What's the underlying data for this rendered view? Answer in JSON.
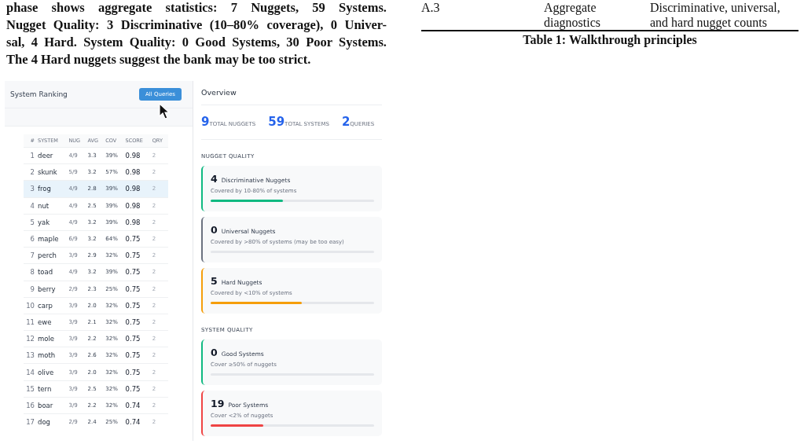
{
  "paragraph_lines": [
    "phase shows aggregate statistics: 7 Nuggets, 59 Systems.",
    "Nugget Quality: 3 Discriminative (10–80% coverage), 0 Univer-",
    "sal, 4 Hard. System Quality: 0 Good Systems, 30 Poor Systems.",
    "The 4 Hard nuggets suggest the bank may be too strict."
  ],
  "table_fragment": {
    "row": {
      "id": "A.3",
      "principle": "Aggregate diagnostics",
      "check": "Discriminative, universal, and hard nugget counts"
    },
    "caption": "Table 1: Walkthrough principles"
  },
  "screenshot": {
    "ranking": {
      "title": "System Ranking",
      "button": "All Queries",
      "columns": [
        "#",
        "SYSTEM",
        "NUG",
        "AVG",
        "COV",
        "SCORE",
        "QRY"
      ],
      "rows": [
        {
          "rank": "1",
          "system": "deer",
          "nug": "4/9",
          "avg": "3.3",
          "cov": "39%",
          "score": "0.98",
          "qry": "2",
          "selected": false
        },
        {
          "rank": "2",
          "system": "skunk",
          "nug": "5/9",
          "avg": "3.2",
          "cov": "57%",
          "score": "0.98",
          "qry": "2",
          "selected": false
        },
        {
          "rank": "3",
          "system": "frog",
          "nug": "4/9",
          "avg": "2.8",
          "cov": "39%",
          "score": "0.98",
          "qry": "2",
          "selected": true
        },
        {
          "rank": "4",
          "system": "nut",
          "nug": "4/9",
          "avg": "2.5",
          "cov": "39%",
          "score": "0.98",
          "qry": "2",
          "selected": false
        },
        {
          "rank": "5",
          "system": "yak",
          "nug": "4/9",
          "avg": "3.2",
          "cov": "39%",
          "score": "0.98",
          "qry": "2",
          "selected": false
        },
        {
          "rank": "6",
          "system": "maple",
          "nug": "6/9",
          "avg": "3.2",
          "cov": "64%",
          "score": "0.75",
          "qry": "2",
          "selected": false
        },
        {
          "rank": "7",
          "system": "perch",
          "nug": "3/9",
          "avg": "2.9",
          "cov": "32%",
          "score": "0.75",
          "qry": "2",
          "selected": false
        },
        {
          "rank": "8",
          "system": "toad",
          "nug": "4/9",
          "avg": "3.2",
          "cov": "39%",
          "score": "0.75",
          "qry": "2",
          "selected": false
        },
        {
          "rank": "9",
          "system": "berry",
          "nug": "2/9",
          "avg": "2.3",
          "cov": "25%",
          "score": "0.75",
          "qry": "2",
          "selected": false
        },
        {
          "rank": "10",
          "system": "carp",
          "nug": "3/9",
          "avg": "2.0",
          "cov": "32%",
          "score": "0.75",
          "qry": "2",
          "selected": false
        },
        {
          "rank": "11",
          "system": "ewe",
          "nug": "3/9",
          "avg": "2.1",
          "cov": "32%",
          "score": "0.75",
          "qry": "2",
          "selected": false
        },
        {
          "rank": "12",
          "system": "mole",
          "nug": "3/9",
          "avg": "2.2",
          "cov": "32%",
          "score": "0.75",
          "qry": "2",
          "selected": false
        },
        {
          "rank": "13",
          "system": "moth",
          "nug": "3/9",
          "avg": "2.6",
          "cov": "32%",
          "score": "0.75",
          "qry": "2",
          "selected": false
        },
        {
          "rank": "14",
          "system": "olive",
          "nug": "3/9",
          "avg": "2.0",
          "cov": "32%",
          "score": "0.75",
          "qry": "2",
          "selected": false
        },
        {
          "rank": "15",
          "system": "tern",
          "nug": "3/9",
          "avg": "2.5",
          "cov": "32%",
          "score": "0.75",
          "qry": "2",
          "selected": false
        },
        {
          "rank": "16",
          "system": "boar",
          "nug": "3/9",
          "avg": "2.2",
          "cov": "32%",
          "score": "0.74",
          "qry": "2",
          "selected": false
        },
        {
          "rank": "17",
          "system": "dog",
          "nug": "2/9",
          "avg": "2.4",
          "cov": "25%",
          "score": "0.74",
          "qry": "2",
          "selected": false
        }
      ]
    },
    "overview": {
      "title": "Overview",
      "stats": [
        {
          "value": "9",
          "label": "TOTAL NUGGETS"
        },
        {
          "value": "59",
          "label": "TOTAL SYSTEMS"
        },
        {
          "value": "2",
          "label": "QUERIES"
        }
      ],
      "sections": [
        {
          "heading": "NUGGET QUALITY",
          "cards": [
            {
              "count": "4",
              "title": "Discriminative Nuggets",
              "description": "Covered by 10-80% of systems",
              "level": 0.44,
              "color": "#10b981"
            },
            {
              "count": "0",
              "title": "Universal Nuggets",
              "description": "Covered by >80% of systems (may be too easy)",
              "color": "#6b7280"
            },
            {
              "count": "5",
              "title": "Hard Nuggets",
              "description": "Covered by <10% of systems",
              "level": 0.56,
              "color": "#f59e0b"
            }
          ]
        },
        {
          "heading": "SYSTEM QUALITY",
          "cards": [
            {
              "count": "0",
              "title": "Good Systems",
              "description": "Cover ≥50% of nuggets",
              "color": "#10b981"
            },
            {
              "count": "19",
              "title": "Poor Systems",
              "description": "Cover <2% of nuggets",
              "level": 0.32,
              "color": "#ef4444"
            }
          ]
        }
      ]
    }
  }
}
